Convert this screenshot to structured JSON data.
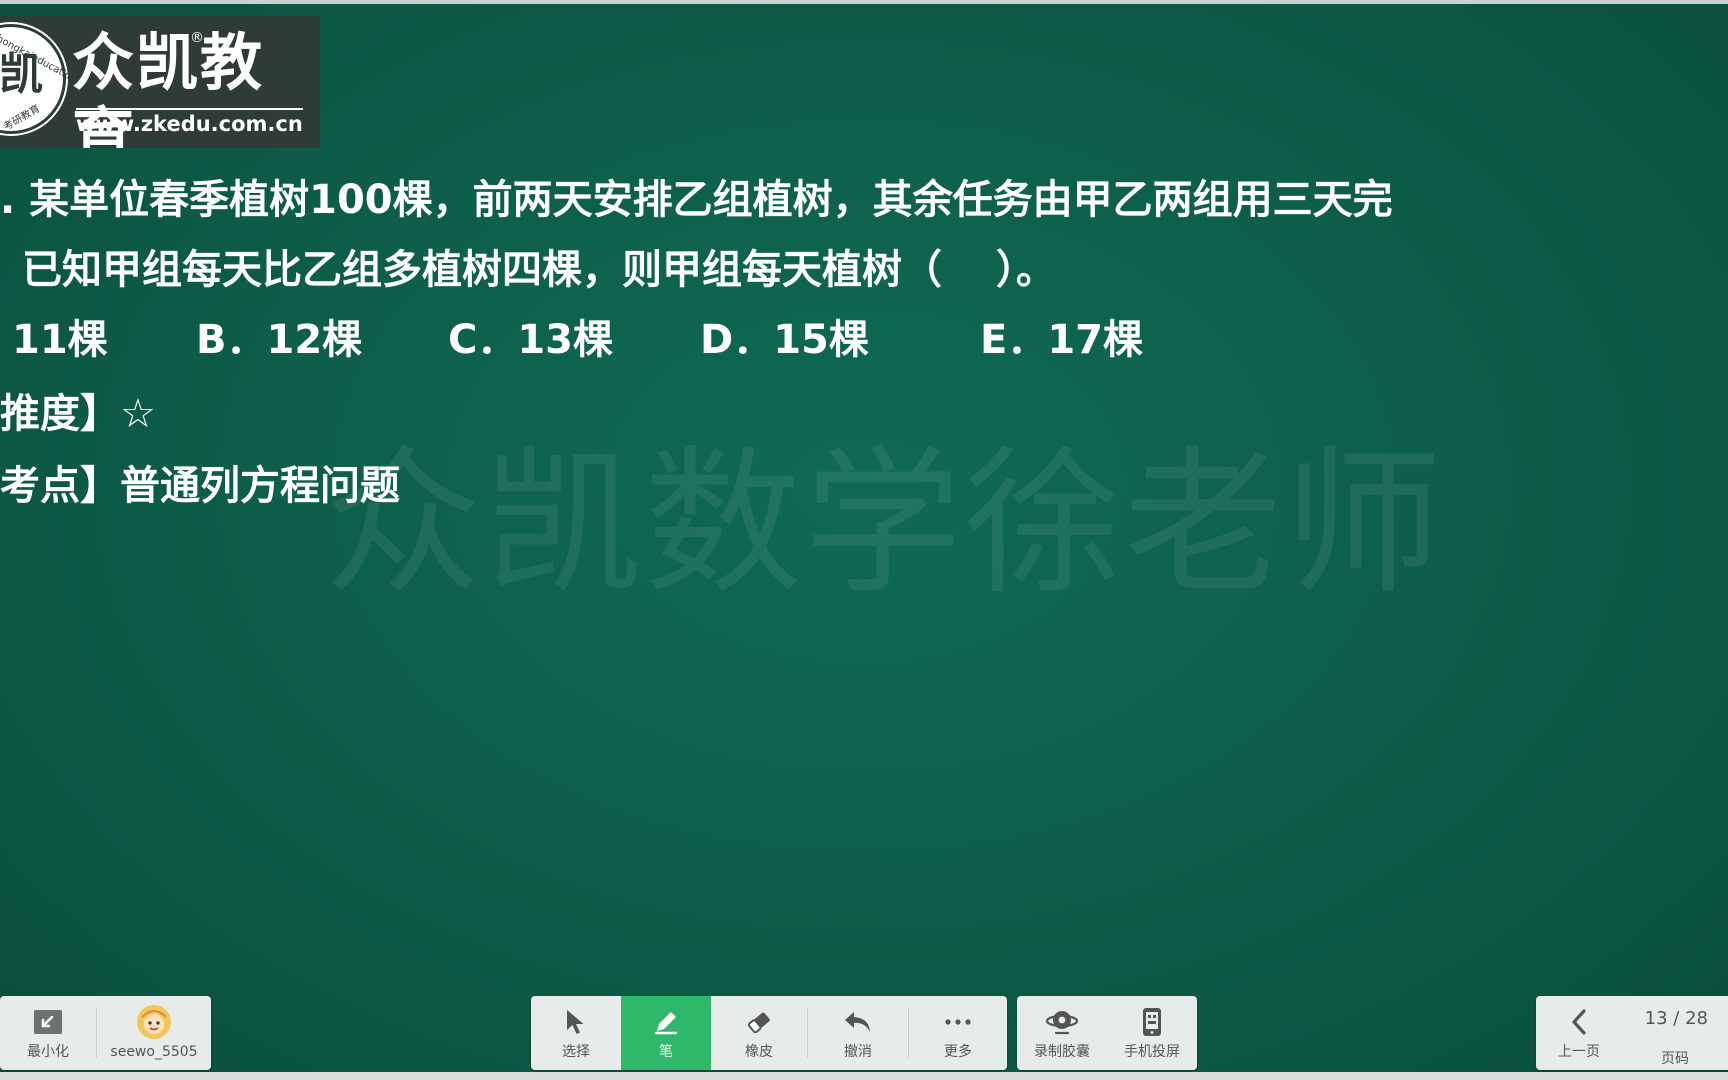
{
  "logo": {
    "brand": "众凯教育",
    "reg_mark": "®",
    "url": "www.zkedu.com.cn",
    "seal_char": "凯",
    "seal_arc_top": "zhongkaieducation",
    "seal_arc_bottom": "考研教育"
  },
  "watermark": "众凯数学徐老师",
  "question": {
    "line1": ". 某单位春季植树100棵，前两天安排乙组植树，其余任务由甲乙两组用三天完",
    "line2": "已知甲组每天比乙组多植树四棵，则甲组每天植树（　 ）。",
    "options": [
      "11棵",
      "B．12棵",
      "C．13棵",
      "D．15棵",
      "E．17棵"
    ],
    "difficulty_label": "推度】",
    "difficulty_value": "☆",
    "topic_label": "考点】",
    "topic_value": "普通列方程问题"
  },
  "toolbar_left": {
    "minimize_label": "最小化",
    "user_label": "seewo_5505"
  },
  "toolbar_center": {
    "select_label": "选择",
    "pen_label": "笔",
    "eraser_label": "橡皮",
    "undo_label": "撤消",
    "more_label": "更多"
  },
  "toolbar_extra": {
    "record_label": "录制胶囊",
    "phone_label": "手机投屏"
  },
  "toolbar_right": {
    "prev_label": "上一页",
    "page_label": "页码",
    "page_value": "13 / 28"
  },
  "colors": {
    "board": "#0d5f4b",
    "active_tool": "#2fb86a",
    "toolbar_bg": "#e7ebea"
  }
}
